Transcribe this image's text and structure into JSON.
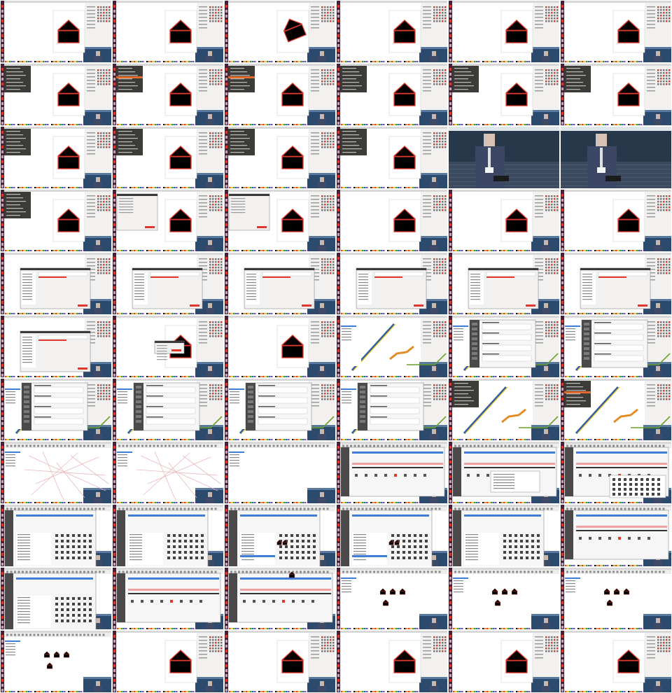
{
  "sheet": {
    "columns": 6,
    "rows": 11
  },
  "palette": {
    "launcher": "#4a1f3a",
    "menubar": "#d8d8d8",
    "dark_panel": "#3c3b37",
    "dock_bg": "#f2f1f0",
    "icon_red": "#e0392b",
    "house_fill": "#000000",
    "house_outline": "#e0392b",
    "video_bg": "#2c4a6e",
    "line_blue": "#2f5f9e",
    "line_orange": "#e38b25",
    "line_green": "#6aa12a",
    "highlight_orange": "#e06b2a",
    "window_title": "#3a3a3a",
    "pink_bar": "#f3a0a0"
  },
  "frames": [
    {
      "type": "house"
    },
    {
      "type": "house"
    },
    {
      "type": "house_rotated"
    },
    {
      "type": "house"
    },
    {
      "type": "house"
    },
    {
      "type": "house"
    },
    {
      "type": "house_menu"
    },
    {
      "type": "house_menu_highlight"
    },
    {
      "type": "house_menu_highlight"
    },
    {
      "type": "house_menu"
    },
    {
      "type": "house_menu"
    },
    {
      "type": "house_menu"
    },
    {
      "type": "house_menu"
    },
    {
      "type": "house_menu"
    },
    {
      "type": "house_menu"
    },
    {
      "type": "house_menu"
    },
    {
      "type": "speaker"
    },
    {
      "type": "speaker"
    },
    {
      "type": "house_menu"
    },
    {
      "type": "house_dialog"
    },
    {
      "type": "house_dialog"
    },
    {
      "type": "house_light"
    },
    {
      "type": "house_light"
    },
    {
      "type": "house_light"
    },
    {
      "type": "dialog_list"
    },
    {
      "type": "dialog_list"
    },
    {
      "type": "dialog_list"
    },
    {
      "type": "dialog_list"
    },
    {
      "type": "dialog_list"
    },
    {
      "type": "dialog_list"
    },
    {
      "type": "dialog_list"
    },
    {
      "type": "house_popup"
    },
    {
      "type": "house"
    },
    {
      "type": "lines"
    },
    {
      "type": "settings"
    },
    {
      "type": "settings"
    },
    {
      "type": "settings"
    },
    {
      "type": "settings"
    },
    {
      "type": "settings"
    },
    {
      "type": "settings"
    },
    {
      "type": "lines_menu"
    },
    {
      "type": "lines_menu_highlight"
    },
    {
      "type": "map"
    },
    {
      "type": "map"
    },
    {
      "type": "blank"
    },
    {
      "type": "symbol_dialog"
    },
    {
      "type": "symbol_dialog_list"
    },
    {
      "type": "symbol_dialog_grid"
    },
    {
      "type": "symbol_grid"
    },
    {
      "type": "symbol_grid"
    },
    {
      "type": "symbol_marker"
    },
    {
      "type": "symbol_marker"
    },
    {
      "type": "symbol_list"
    },
    {
      "type": "symbol_pink"
    },
    {
      "type": "symbol_grid"
    },
    {
      "type": "symbol_pink"
    },
    {
      "type": "symbol_single"
    },
    {
      "type": "small_houses"
    },
    {
      "type": "small_houses"
    },
    {
      "type": "small_houses"
    },
    {
      "type": "small_houses"
    },
    {
      "type": "house_big"
    },
    {
      "type": "house_big"
    },
    {
      "type": "house_big"
    },
    {
      "type": "house_big"
    },
    {
      "type": "house_big"
    }
  ]
}
